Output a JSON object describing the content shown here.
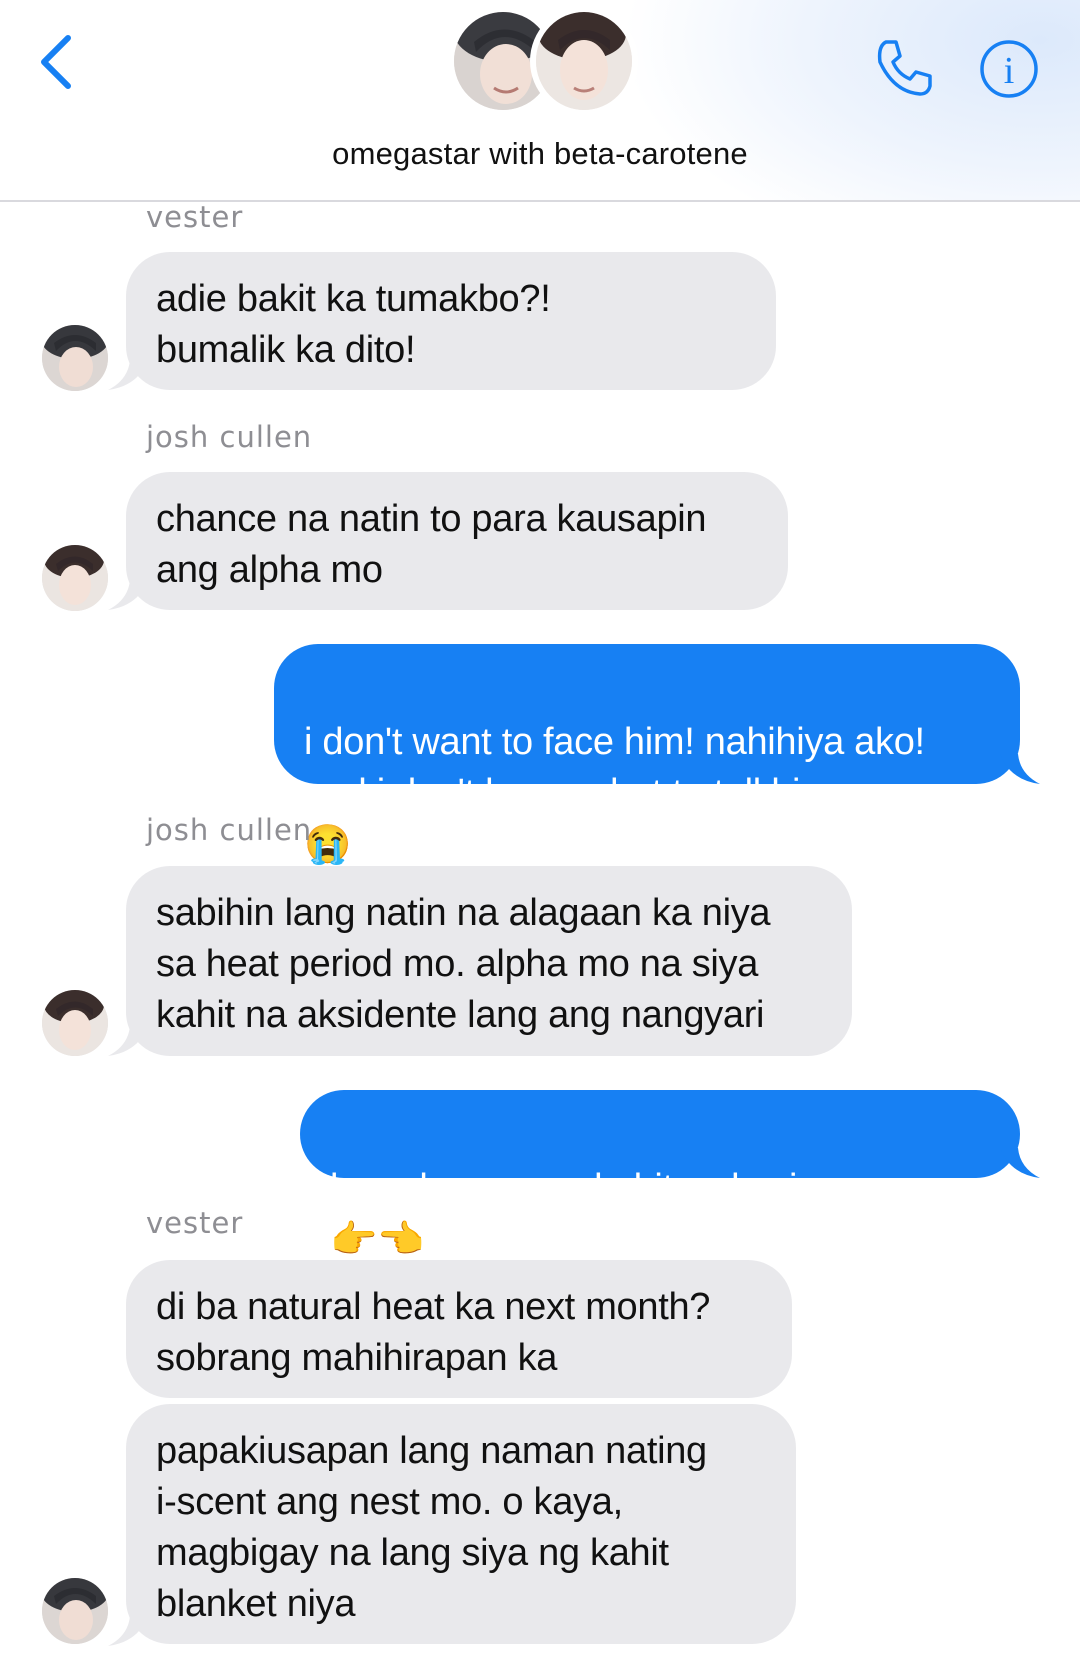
{
  "header": {
    "title": "omegastar with beta-carotene",
    "back_icon": "chevron-left-icon",
    "call_icon": "phone-icon",
    "info_icon": "info-icon",
    "accent_color": "#1780f3"
  },
  "messages": [
    {
      "sender": "vester",
      "direction": "in",
      "text": "adie bakit ka tumakbo?!\nbumalik ka dito!"
    },
    {
      "sender": "josh cullen",
      "direction": "in",
      "text": "chance na natin to para kausapin\nang alpha mo"
    },
    {
      "direction": "out",
      "text": "i don't want to face him! nahihiya ako!\nand i don't know what to tell him",
      "emoji": "😭"
    },
    {
      "sender": "josh cullen",
      "direction": "in",
      "text": "sabihin lang natin na alagaan ka niya\nsa heat period mo. alpha mo na siya\nkahit na aksidente lang ang nangyari"
    },
    {
      "direction": "out",
      "text": "kaya ko naman kahit wala siya",
      "emoji": "👉👈"
    },
    {
      "sender": "vester",
      "direction": "in",
      "text": "di ba natural heat ka next month?\nsobrang mahihirapan ka"
    },
    {
      "sender": "vester",
      "direction": "in",
      "text": "papakiusapan lang naman nating\ni-scent ang nest mo. o kaya,\nmagbigay na lang siya ng kahit\nblanket niya"
    }
  ],
  "colors": {
    "incoming_bubble": "#e9e9ec",
    "outgoing_bubble": "#1780f3",
    "sender_name": "#8e8e93"
  }
}
